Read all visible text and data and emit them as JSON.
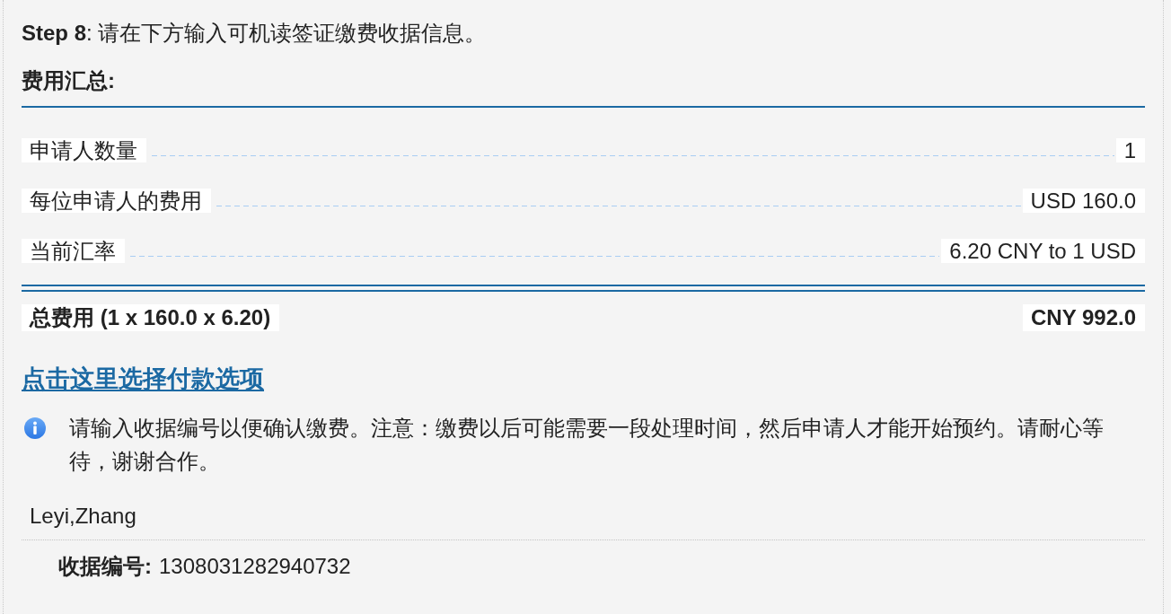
{
  "step": {
    "text": "**Step 8**: 请在下方输入可机读签证缴费收据信息。"
  },
  "fee_summary": {
    "heading": "费用汇总:",
    "items": [
      {
        "label": "申请人数量",
        "value": "1"
      },
      {
        "label": "每位申请人的费用",
        "value": "USD 160.0"
      },
      {
        "label": "当前汇率",
        "value": "6.20 CNY to 1 USD"
      }
    ],
    "total": {
      "label": "总费用 (1 x 160.0 x 6.20)",
      "value": "CNY 992.0"
    }
  },
  "payment_link": "点击这里选择付款选项",
  "info_note": "请输入收据编号以便确认缴费。注意：缴费以后可能需要一段处理时间，然后申请人才能开始预约。请耐心等待，谢谢合作。",
  "applicants": [
    {
      "name": "Leyi,Zhang",
      "receipt_label": "收据编号:",
      "receipt_number": "1308031282940732"
    }
  ]
}
